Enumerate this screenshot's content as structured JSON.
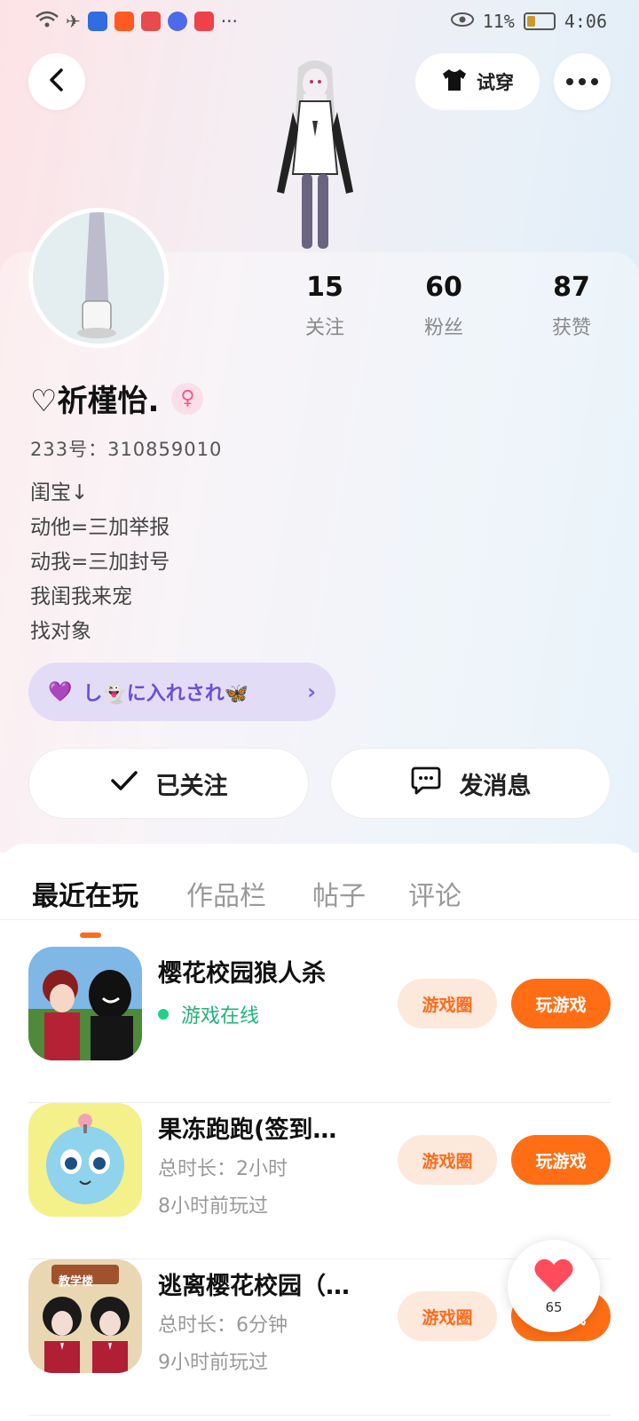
{
  "status_bar": {
    "battery_percent": "11%",
    "time": "4:06",
    "more": "···"
  },
  "header": {
    "back_icon": "chevron-left-icon",
    "try_on_label": "试穿",
    "more_icon": "more-dots-icon"
  },
  "profile": {
    "stats": [
      {
        "value": "15",
        "label": "关注"
      },
      {
        "value": "60",
        "label": "粉丝"
      },
      {
        "value": "87",
        "label": "获赞"
      }
    ],
    "name": "♡祈槿怡.",
    "gender_symbol": "♀",
    "id_text": "233号：310859010",
    "bio_lines": [
      "闺宝↓",
      "动他=三加举报",
      "动我=三加封号",
      "我闺我来宠",
      "找对象"
    ],
    "tag": {
      "heart": "💜",
      "text": "し👻に入れされ🦋",
      "chevron": "›"
    }
  },
  "actions": {
    "follow_label": "已关注",
    "message_label": "发消息"
  },
  "tabs": [
    {
      "label": "最近在玩",
      "active": true
    },
    {
      "label": "作品栏",
      "active": false
    },
    {
      "label": "帖子",
      "active": false
    },
    {
      "label": "评论",
      "active": false
    }
  ],
  "games": [
    {
      "title": "樱花校园狼人杀",
      "line1": "游戏在线",
      "line2": "",
      "online": true,
      "circle_label": "游戏圈",
      "play_label": "玩游戏"
    },
    {
      "title": "果冻跑跑(签到…",
      "line1": "总时长：2小时",
      "line2": "8小时前玩过",
      "online": false,
      "circle_label": "游戏圈",
      "play_label": "玩游戏"
    },
    {
      "title": "逃离樱花校园（…",
      "line1": "总时长：6分钟",
      "line2": "9小时前玩过",
      "online": false,
      "circle_label": "游戏圈",
      "play_label": "玩游戏",
      "icon_label": "教学楼"
    }
  ],
  "like_float": {
    "count": "65"
  },
  "colors": {
    "accent": "#ff6e14",
    "online": "#22d08a",
    "tag_bg": "#e3dcf7",
    "tag_text": "#6a4fd6"
  }
}
